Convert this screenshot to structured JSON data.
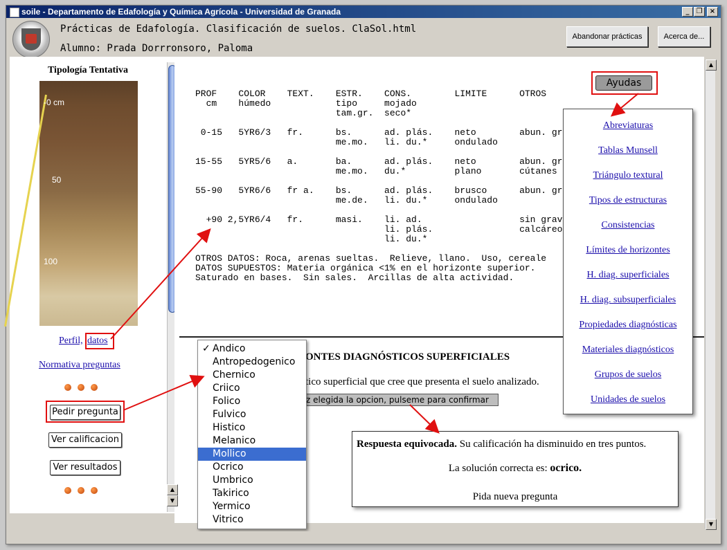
{
  "window": {
    "title": "soile - Departamento de Edafología y Química Agrícola - Universidad de Granada"
  },
  "header": {
    "line1": "Prácticas de Edafología. Clasificación de suelos. ClaSol.html",
    "line2": "Alumno: Prada Dorrronsoro, Paloma",
    "abandon_label": "Abandonar prácticas",
    "about_label": "Acerca de..."
  },
  "left": {
    "title": "Tipología Tentativa",
    "photo_labels": [
      "-0 cm",
      "50",
      "100"
    ],
    "perfil_link": "Perfil,",
    "datos_link": "datos",
    "normativa_link": "Normativa preguntas",
    "pedir_label": "Pedir pregunta",
    "ver_calif_label": "Ver calificacion",
    "ver_result_label": "Ver resultados"
  },
  "table": {
    "head": "PROF    COLOR    TEXT.    ESTR.    CONS.        LIMITE      OTROS\n  cm    húmedo            tipo     mojado\n                          tam.gr.  seco*",
    "row1": " 0-15   5YR6/3   fr.      bs.      ad. plás.    neto        abun. gra\n                          me.mo.   li. du.*     ondulado",
    "row2": "15-55   5YR5/6   a.       ba.      ad. plás.    neto        abun. gra\n                          me.mo.   du.*         plano       cútanes d",
    "row3": "55-90   5YR6/6   fr a.    bs.      ad. plás.    brusco      abun. gra\n                          me.de.   li. du.*     ondulado",
    "row4": "  +90 2,5YR6/4   fr.      masi.    li. ad.                  sin grava\n                                   li. plás.                calcáreo\n                                   li. du.*",
    "otros": "OTROS DATOS: Roca, arenas sueltas.  Relieve, llano.  Uso, cereale\nDATOS SUPUESTOS: Materia orgánica <1% en el horizonte superior.\nSaturado en bases.  Sin sales.  Arcillas de alta actividad."
  },
  "question": {
    "heading": "ONTES DIAGNÓSTICOS SUPERFICIALES",
    "instruction": "tico superficial que cree que presenta el suelo analizado.",
    "confirm_label": "z elegida la opcion, pulseme para confirmar"
  },
  "help": {
    "button_label": "Ayudas",
    "links": [
      "Abreviaturas",
      "Tablas Munsell",
      "Triángulo textural",
      "Tipos de estructuras",
      "Consistencias",
      "Límites de horizontes",
      "H. diag. superficiales",
      "H. diag. subsuperficiales",
      "Propiedades diagnósticas",
      "Materiales diagnósticos",
      "Grupos de suelos",
      "Unidades de suelos"
    ]
  },
  "dropdown": {
    "checked": "Andico",
    "highlighted": "Mollico",
    "options": [
      "Andico",
      "Antropedogenico",
      "Chernico",
      "Criico",
      "Folico",
      "Fulvico",
      "Histico",
      "Melanico",
      "Mollico",
      "Ocrico",
      "Umbrico",
      "Takirico",
      "Yermico",
      "Vitrico"
    ]
  },
  "response": {
    "bold": "Respuesta equivocada.",
    "rest": " Su calificación ha disminuido en tres puntos.",
    "solution_prefix": "La solución correcta es: ",
    "solution": "ocrico.",
    "new_question": "Pida nueva pregunta"
  },
  "colors": {
    "annotation_red": "#e01010",
    "link_blue": "#1a0dab",
    "selected_blue": "#3b6dd0"
  }
}
